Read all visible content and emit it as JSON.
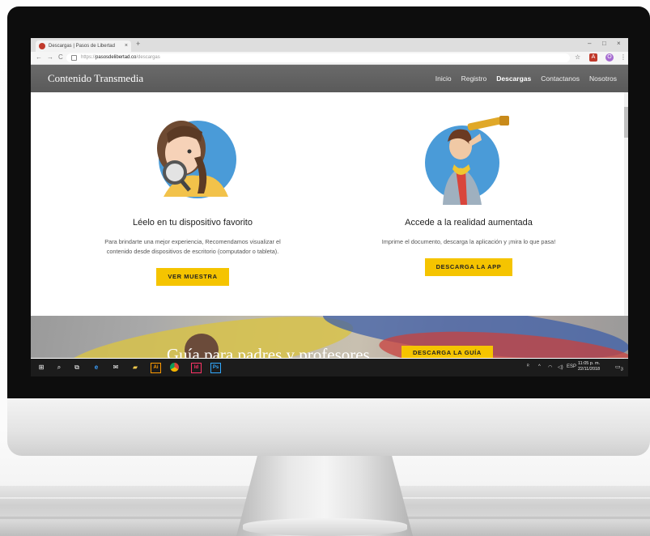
{
  "browser": {
    "tab_title": "Descargas | Pasos de Libertad",
    "tab_close": "×",
    "new_tab": "+",
    "url_scheme": "https://",
    "url_domain": "pasosdelibertad.co",
    "url_path": "/descargas",
    "back": "←",
    "forward": "→",
    "reload": "C",
    "minimize": "–",
    "maximize": "□",
    "close": "×",
    "star": "☆",
    "menu": "⋮"
  },
  "site": {
    "brand": "Contenido Transmedia",
    "menu": [
      "Inicio",
      "Registro",
      "Descargas",
      "Contactanos",
      "Nosotros"
    ],
    "active_menu": "Descargas"
  },
  "features": [
    {
      "heading": "Léelo en tu dispositivo favorito",
      "description_line1": "Para brindarte una mejor experiencia, Recomendamos visualizar el",
      "description_line2": "contenido desde dispositivos de escritorio (computador o tableta).",
      "button": "VER MUESTRA",
      "illustration": "girl-with-magnifying-glass"
    },
    {
      "heading": "Accede a la realidad aumentada",
      "description_line1": "Imprime el documento, descarga la aplicación y ¡mira lo que pasa!",
      "description_line2": "",
      "button": "DESCARGA LA APP",
      "illustration": "explorer-with-telescope"
    }
  ],
  "banner": {
    "title": "Guía para padres y profesores",
    "button": "DESCARGA LA GUÍA"
  },
  "taskbar": {
    "apps": [
      "start-icon",
      "search-icon",
      "task-view-icon",
      "edge-icon",
      "mail-icon",
      "file-explorer-icon",
      "illustrator-icon",
      "chrome-icon",
      "indesign-icon",
      "photoshop-icon"
    ],
    "illustrator_label": "Ai",
    "indesign_label": "Id",
    "photoshop_label": "Ps",
    "language": "ESP",
    "time": "11:05 p. m.",
    "date": "22/11/2018",
    "notifications": "3"
  },
  "colors": {
    "accent": "#f5c400",
    "header": "#5e5e5e",
    "taskbar": "#1c1c1c"
  }
}
